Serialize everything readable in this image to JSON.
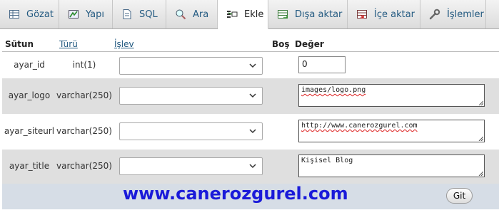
{
  "tabs": [
    {
      "label": "Gözat",
      "icon": "browse-icon"
    },
    {
      "label": "Yapı",
      "icon": "structure-icon"
    },
    {
      "label": "SQL",
      "icon": "sql-icon"
    },
    {
      "label": "Ara",
      "icon": "search-icon"
    },
    {
      "label": "Ekle",
      "icon": "insert-icon",
      "active": true
    },
    {
      "label": "Dışa aktar",
      "icon": "export-icon"
    },
    {
      "label": "İçe aktar",
      "icon": "import-icon"
    },
    {
      "label": "İşlemler",
      "icon": "wrench-icon"
    }
  ],
  "table": {
    "headers": {
      "sutun": "Sütun",
      "turu": "Türü",
      "islev": "İşlev",
      "bos": "Boş",
      "deger": "Değer"
    },
    "rows": [
      {
        "name": "ayar_id",
        "type": "int(1)",
        "function": "",
        "value": "0"
      },
      {
        "name": "ayar_logo",
        "type": "varchar(250)",
        "function": "",
        "value": "images/logo.png"
      },
      {
        "name": "ayar_siteurl",
        "type": "varchar(250)",
        "function": "",
        "value": "http://www.canerozgurel.com"
      },
      {
        "name": "ayar_title",
        "type": "varchar(250)",
        "function": "",
        "value": "Kişisel Blog"
      }
    ]
  },
  "footer": {
    "watermark": "www.canerozgurel.com",
    "go_label": "Git"
  },
  "colors": {
    "link": "#235a81",
    "watermark": "#1a1ad9",
    "footer_bg": "#d6dde6",
    "row_alt": "#dfdfdf"
  }
}
